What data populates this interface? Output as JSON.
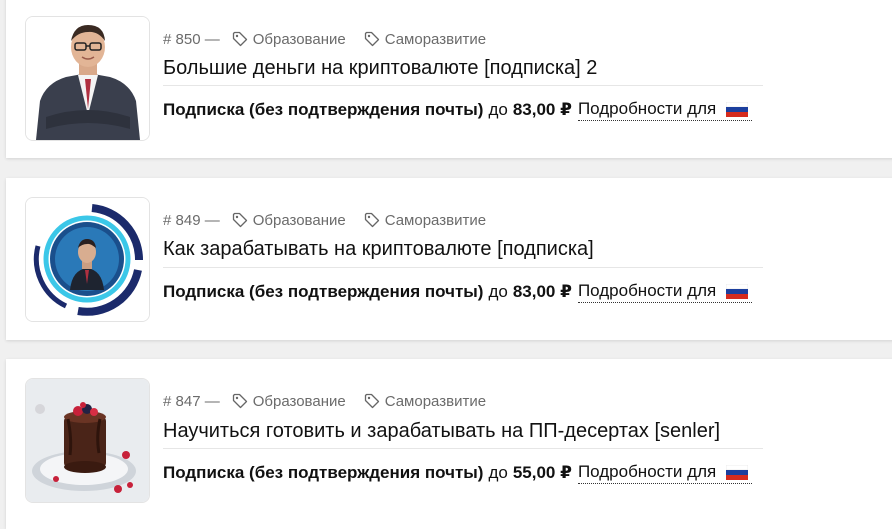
{
  "items": [
    {
      "number": "# 850 —",
      "tags": [
        "Образование",
        "Саморазвитие"
      ],
      "title": "Большие деньги на криптовалюте [подписка] 2",
      "plan": "Подписка (без подтверждения почты)",
      "upto": "до",
      "price": "83,00 ₽",
      "details": "Подробности для",
      "flag": "russia-flag-icon"
    },
    {
      "number": "# 849 —",
      "tags": [
        "Образование",
        "Саморазвитие"
      ],
      "title": "Как зарабатывать на криптовалюте [подписка]",
      "plan": "Подписка (без подтверждения почты)",
      "upto": "до",
      "price": "83,00 ₽",
      "details": "Подробности для",
      "flag": "russia-flag-icon"
    },
    {
      "number": "# 847 —",
      "tags": [
        "Образование",
        "Саморазвитие"
      ],
      "title": "Научиться готовить и зарабатывать на ПП-десертах [senler]",
      "plan": "Подписка (без подтверждения почты)",
      "upto": "до",
      "price": "55,00 ₽",
      "details": "Подробности для",
      "flag": "russia-flag-icon"
    }
  ],
  "colors": {
    "card_bg": "#ffffff",
    "page_bg": "#f0f0f0",
    "meta_text": "#6b6b6b",
    "flag_white": "#ffffff",
    "flag_blue": "#1c3f9e",
    "flag_red": "#d52b1e"
  }
}
